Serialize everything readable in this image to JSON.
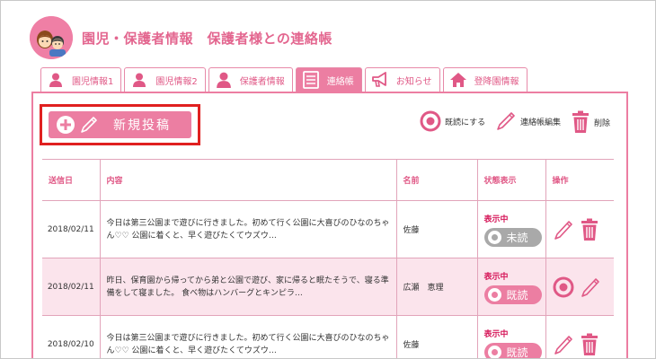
{
  "header": {
    "title": "園児・保護者情報　保護者様との連絡帳"
  },
  "tabs": [
    {
      "label": "園児情報1",
      "icon": "person-icon",
      "active": false
    },
    {
      "label": "園児情報2",
      "icon": "person-icon",
      "active": false
    },
    {
      "label": "保護者情報",
      "icon": "person-icon",
      "active": false
    },
    {
      "label": "連絡帳",
      "icon": "notebook-icon",
      "active": true
    },
    {
      "label": "お知らせ",
      "icon": "megaphone-icon",
      "active": false
    },
    {
      "label": "登降園情報",
      "icon": "house-icon",
      "active": false
    }
  ],
  "toolbar": {
    "new_post_label": "新規投稿",
    "mark_read_label": "既読にする",
    "edit_label": "連絡帳編集",
    "delete_label": "削除"
  },
  "table": {
    "headers": [
      "送信日",
      "内容",
      "名前",
      "状態表示",
      "操作"
    ],
    "rows": [
      {
        "date": "2018/02/11",
        "content": "今日は第三公園まで遊びに行きました。初めて行く公園に大喜びのひなのちゃん♡♡ 公園に着くと、早く遊びたくてウズウ…",
        "name": "佐藤",
        "status_label": "表示中",
        "read_state": "未読"
      },
      {
        "date": "2018/02/11",
        "content": "昨日、保育園から帰ってから弟と公園で遊び、家に帰ると眠たそうで、寝る準備をして寝ました。 食べ物はハンバーグとキンピラ…",
        "name": "広瀬　恵理",
        "status_label": "表示中",
        "read_state": "既読"
      },
      {
        "date": "2018/02/10",
        "content": "今日は第三公園まで遊びに行きました。初めて行く公園に大喜びのひなのちゃん♡♡ 公園に着くと、早く遊びたくてウズウ…",
        "name": "佐藤",
        "status_label": "表示中",
        "read_state": "既読"
      }
    ]
  },
  "colors": {
    "accent": "#ec7ea2",
    "accent_text": "#e05886",
    "status_red": "#d6185a",
    "unread_gray": "#a9a9a9",
    "highlight_red": "#e02020"
  }
}
